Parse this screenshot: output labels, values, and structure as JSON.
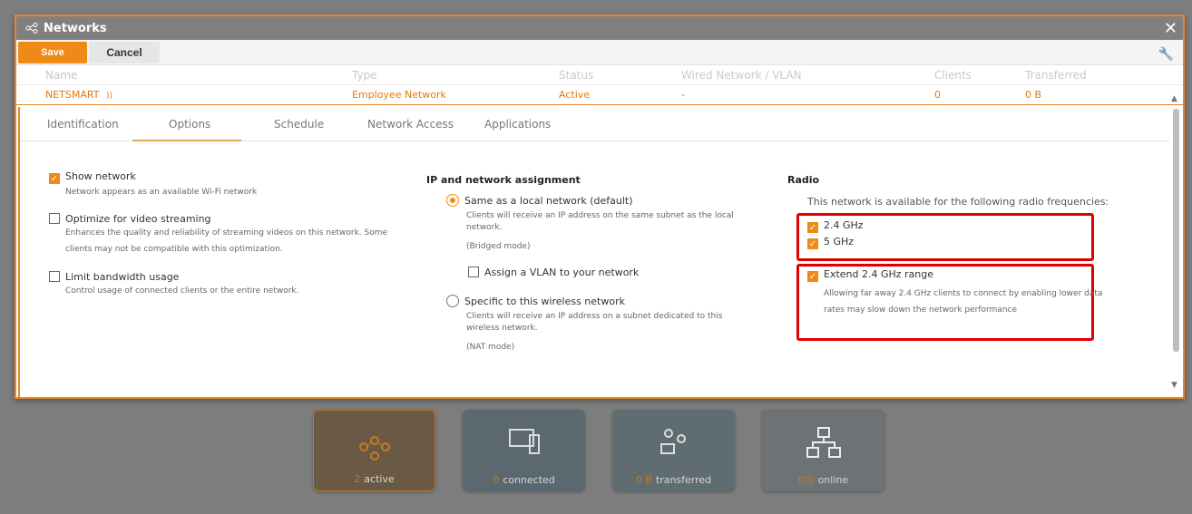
{
  "modal": {
    "title": "Networks",
    "close_icon": "close-icon",
    "toolbar": {
      "save_label": "Save",
      "cancel_label": "Cancel"
    }
  },
  "table": {
    "headers": [
      "Name",
      "Type",
      "Status",
      "Wired Network / VLAN",
      "Clients",
      "Transferred"
    ],
    "row": {
      "name": "NETSMART",
      "type": "Employee Network",
      "status": "Active",
      "wired": "-",
      "clients": "0",
      "transferred": "0 B"
    }
  },
  "tabs": [
    "Identification",
    "Options",
    "Schedule",
    "Network Access",
    "Applications"
  ],
  "active_tab": "Options",
  "options": {
    "show_network": {
      "label": "Show network",
      "desc": "Network appears as an available Wi-Fi network",
      "checked": true
    },
    "video": {
      "label": "Optimize for video streaming",
      "desc1": "Enhances the quality and reliability of streaming videos on this network. Some",
      "desc2": "clients may not be compatible with this optimization.",
      "checked": false
    },
    "bandwidth": {
      "label": "Limit bandwidth usage",
      "desc": "Control usage of connected clients or the entire network.",
      "checked": false
    }
  },
  "ip": {
    "heading": "IP and network assignment",
    "same": {
      "label": "Same as a local network (default)",
      "desc1": "Clients will receive an IP address on the same subnet as the local",
      "desc2": "network.",
      "mode": "(Bridged mode)",
      "selected": true
    },
    "vlan": {
      "label": "Assign a VLAN to your network",
      "checked": false
    },
    "specific": {
      "label": "Specific to this wireless network",
      "desc1": "Clients will receive an IP address on a subnet dedicated to this",
      "desc2": "wireless network.",
      "mode": "(NAT mode)",
      "selected": false
    }
  },
  "radio": {
    "heading": "Radio",
    "desc": "This network is available for the following radio frequencies:",
    "ghz24": {
      "label": "2.4 GHz",
      "checked": true
    },
    "ghz5": {
      "label": "5 GHz",
      "checked": true
    },
    "extend": {
      "label": "Extend 2.4 GHz range",
      "desc1": "Allowing far away 2.4 GHz clients to connect by enabling lower data",
      "desc2": "rates may slow down the network performance",
      "checked": true
    }
  },
  "tiles": [
    {
      "num": "2",
      "label": "active"
    },
    {
      "num": "0",
      "label": "connected"
    },
    {
      "num": "0 B",
      "label": "transferred"
    },
    {
      "num": "0/0",
      "label": "online"
    }
  ],
  "colors": {
    "accent": "#f08a16",
    "highlight": "#e00000"
  }
}
